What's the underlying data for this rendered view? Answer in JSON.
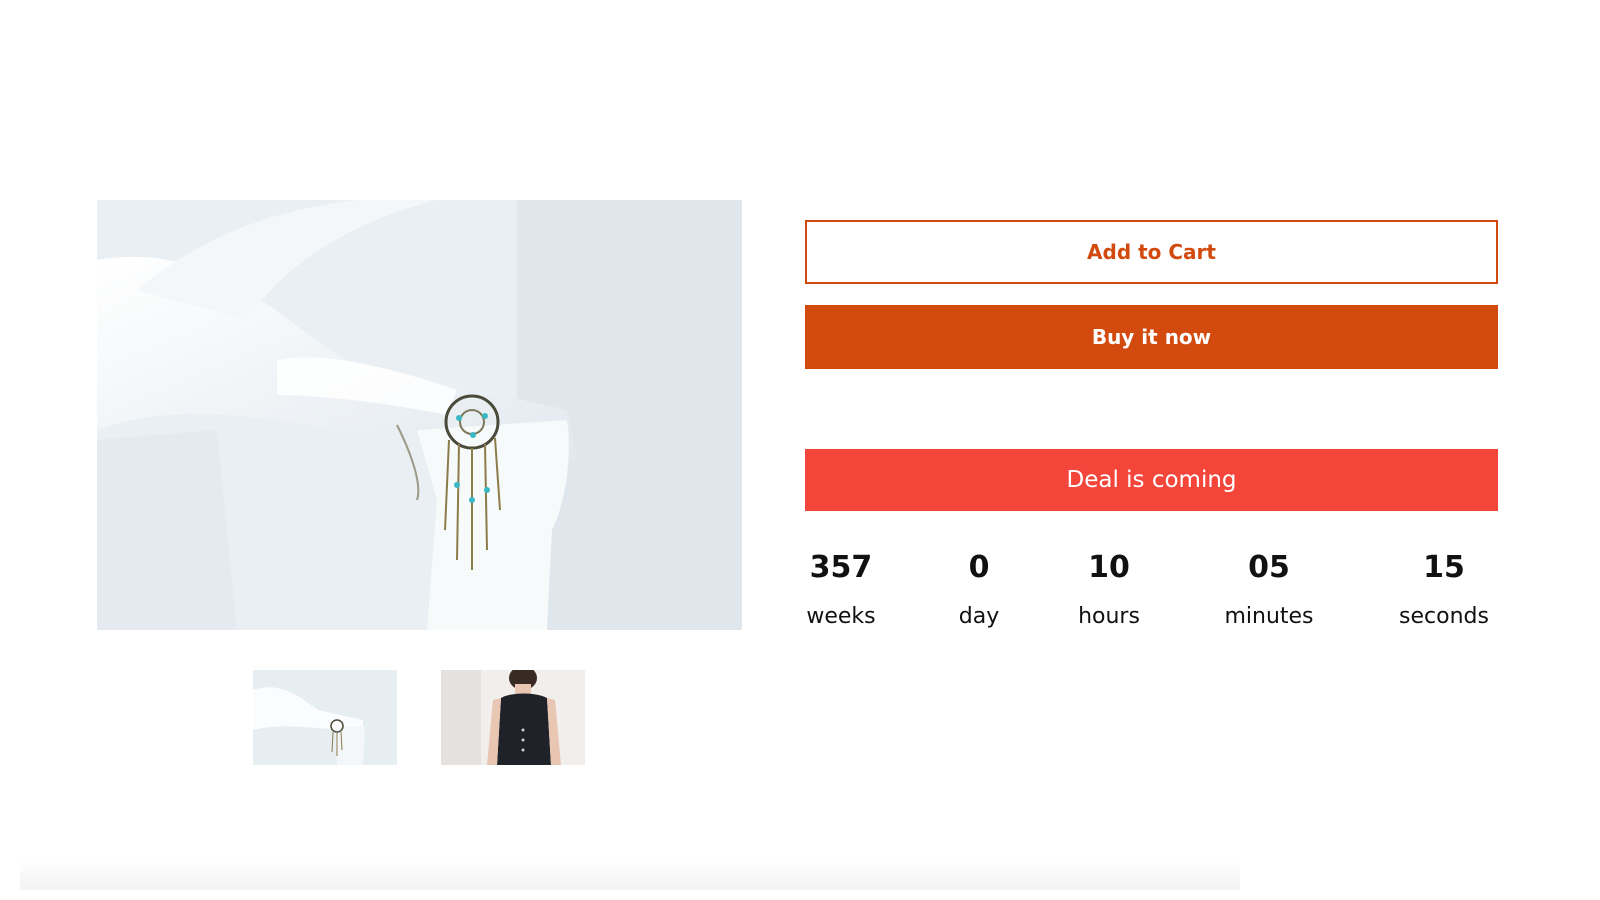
{
  "gallery": {
    "main_image": "dreamcatcher-jewelry-on-white-chair",
    "thumbnails": [
      {
        "label": "dreamcatcher-on-chair-thumbnail"
      },
      {
        "label": "model-wearing-necklace-thumbnail"
      }
    ]
  },
  "actions": {
    "add_to_cart": "Add to Cart",
    "buy_now": "Buy it now"
  },
  "deal": {
    "banner": "Deal is coming"
  },
  "countdown": {
    "weeks": {
      "value": "357",
      "label": "weeks"
    },
    "days": {
      "value": "0",
      "label": "day"
    },
    "hours": {
      "value": "10",
      "label": "hours"
    },
    "minutes": {
      "value": "05",
      "label": "minutes"
    },
    "seconds": {
      "value": "15",
      "label": "seconds"
    }
  },
  "colors": {
    "accent": "#d24a0e",
    "deal_red": "#f4453b"
  }
}
